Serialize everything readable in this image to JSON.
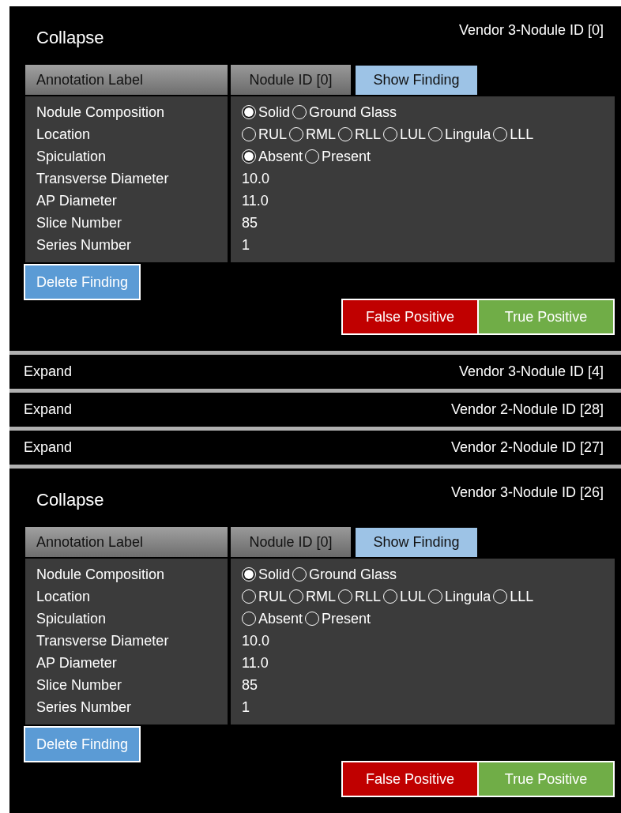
{
  "panels": [
    {
      "toggle": "Collapse",
      "title": "Vendor 3-Nodule ID [0]",
      "expanded": true,
      "column_header": "Annotation Label",
      "nodule_id": "Nodule ID [0]",
      "show_button": "Show Finding",
      "fields": [
        {
          "kind": "radio",
          "label": "Nodule Composition",
          "options": [
            {
              "label": "Solid",
              "selected": true
            },
            {
              "label": "Ground Glass",
              "selected": false
            }
          ]
        },
        {
          "kind": "radio",
          "label": "Location",
          "options": [
            {
              "label": "RUL",
              "selected": false
            },
            {
              "label": "RML",
              "selected": false
            },
            {
              "label": "RLL",
              "selected": false
            },
            {
              "label": "LUL",
              "selected": false
            },
            {
              "label": "Lingula",
              "selected": false
            },
            {
              "label": "LLL",
              "selected": false
            }
          ]
        },
        {
          "kind": "radio",
          "label": "Spiculation",
          "options": [
            {
              "label": "Absent",
              "selected": true
            },
            {
              "label": "Present",
              "selected": false
            }
          ]
        },
        {
          "kind": "text",
          "label": "Transverse Diameter",
          "value": "10.0"
        },
        {
          "kind": "text",
          "label": "AP Diameter",
          "value": "11.0"
        },
        {
          "kind": "text",
          "label": "Slice Number",
          "value": "85"
        },
        {
          "kind": "text",
          "label": "Series Number",
          "value": "1"
        }
      ],
      "delete_button": "Delete Finding",
      "false_positive_button": "False Positive",
      "true_positive_button": "True Positive"
    },
    {
      "toggle": "Expand",
      "title": "Vendor 3-Nodule ID [4]",
      "expanded": false
    },
    {
      "toggle": "Expand",
      "title": "Vendor 2-Nodule ID [28]",
      "expanded": false
    },
    {
      "toggle": "Expand",
      "title": "Vendor 2-Nodule ID [27]",
      "expanded": false
    },
    {
      "toggle": "Collapse",
      "title": "Vendor 3-Nodule ID [26]",
      "expanded": true,
      "column_header": "Annotation Label",
      "nodule_id": "Nodule ID [0]",
      "show_button": "Show Finding",
      "fields": [
        {
          "kind": "radio",
          "label": "Nodule Composition",
          "options": [
            {
              "label": "Solid",
              "selected": true
            },
            {
              "label": "Ground Glass",
              "selected": false
            }
          ]
        },
        {
          "kind": "radio",
          "label": "Location",
          "options": [
            {
              "label": "RUL",
              "selected": false
            },
            {
              "label": "RML",
              "selected": false
            },
            {
              "label": "RLL",
              "selected": false
            },
            {
              "label": "LUL",
              "selected": false
            },
            {
              "label": "Lingula",
              "selected": false
            },
            {
              "label": "LLL",
              "selected": false
            }
          ]
        },
        {
          "kind": "radio",
          "label": "Spiculation",
          "options": [
            {
              "label": "Absent",
              "selected": false
            },
            {
              "label": "Present",
              "selected": false
            }
          ]
        },
        {
          "kind": "text",
          "label": "Transverse Diameter",
          "value": "10.0"
        },
        {
          "kind": "text",
          "label": "AP Diameter",
          "value": "11.0"
        },
        {
          "kind": "text",
          "label": "Slice Number",
          "value": "85"
        },
        {
          "kind": "text",
          "label": "Series Number",
          "value": "1"
        }
      ],
      "delete_button": "Delete Finding",
      "false_positive_button": "False Positive",
      "true_positive_button": "True Positive"
    }
  ]
}
